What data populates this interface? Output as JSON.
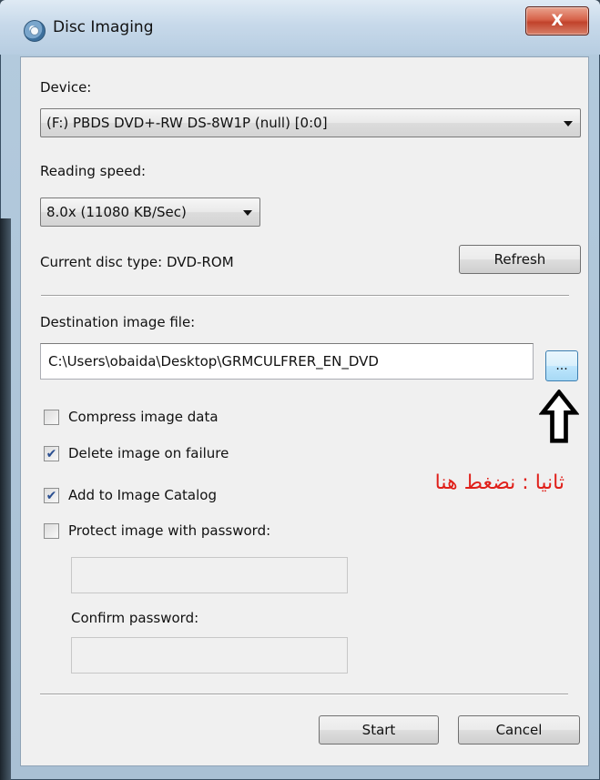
{
  "window": {
    "title": "Disc Imaging",
    "close_label": "X"
  },
  "device": {
    "label": "Device:",
    "selected": "(F:) PBDS DVD+-RW DS-8W1P (null) [0:0]"
  },
  "reading_speed": {
    "label": "Reading speed:",
    "selected": "8.0x (11080 KB/Sec)"
  },
  "disc": {
    "current_type_text": "Current disc type: DVD-ROM",
    "refresh_label": "Refresh"
  },
  "destination": {
    "label": "Destination image file:",
    "value": "C:\\Users\\obaida\\Desktop\\GRMCULFRER_EN_DVD",
    "browse_label": "..."
  },
  "options": [
    {
      "label": "Compress image data",
      "checked": false
    },
    {
      "label": "Delete image on failure",
      "checked": true
    },
    {
      "label": "Add to Image Catalog",
      "checked": true
    },
    {
      "label": "Protect image with password:",
      "checked": false
    }
  ],
  "password": {
    "confirm_label": "Confirm password:"
  },
  "buttons": {
    "start_label": "Start",
    "cancel_label": "Cancel"
  },
  "annotation": {
    "text": "ثانيا : نضغط هنا",
    "color": "#e0201a"
  },
  "check_glyph": "✔"
}
